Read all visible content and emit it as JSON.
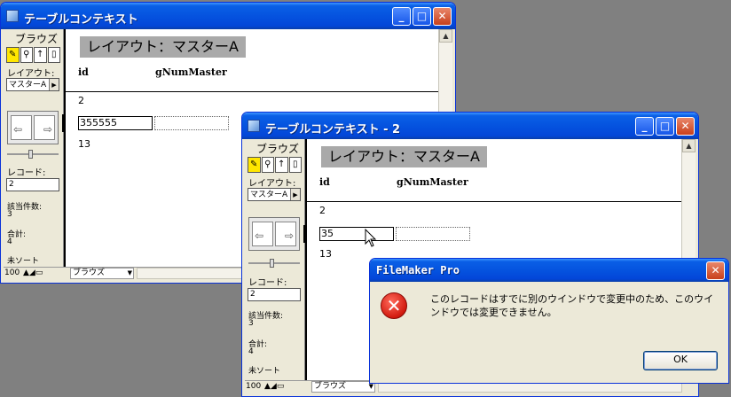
{
  "windows": [
    {
      "title": "テーブルコンテキスト",
      "mode_label": "ブラウズ",
      "layout_label": "レイアウト:",
      "layout_value": "マスターA",
      "record_label": "レコード:",
      "record_value": "2",
      "found_label": "該当件数:",
      "found_value": "3",
      "total_label": "合計:",
      "total_value": "4",
      "sort_label": "未ソート",
      "zoom": "100",
      "mode_select": "ブラウズ",
      "layout_title": "レイアウト：マスターA",
      "headers": [
        "id",
        "gNumMaster"
      ],
      "records": [
        "2",
        "355555",
        "13"
      ]
    },
    {
      "title": "テーブルコンテキスト - 2",
      "mode_label": "ブラウズ",
      "layout_label": "レイアウト:",
      "layout_value": "マスターA",
      "record_label": "レコード:",
      "record_value": "2",
      "found_label": "該当件数:",
      "found_value": "3",
      "total_label": "合計:",
      "total_value": "4",
      "sort_label": "未ソート",
      "zoom": "100",
      "mode_select": "ブラウズ",
      "layout_title": "レイアウト：マスターA",
      "headers": [
        "id",
        "gNumMaster"
      ],
      "records": [
        "2",
        "35",
        "13"
      ]
    }
  ],
  "dialog": {
    "title": "FileMaker Pro",
    "message": "このレコードはすでに別のウインドウで変更中のため、このウインドウでは変更できません。",
    "ok_label": "OK",
    "icon": "error-icon"
  },
  "colors": {
    "titlebar": "#0553df",
    "desktop": "#808080",
    "layout_title_bg": "#a9a9a9"
  }
}
